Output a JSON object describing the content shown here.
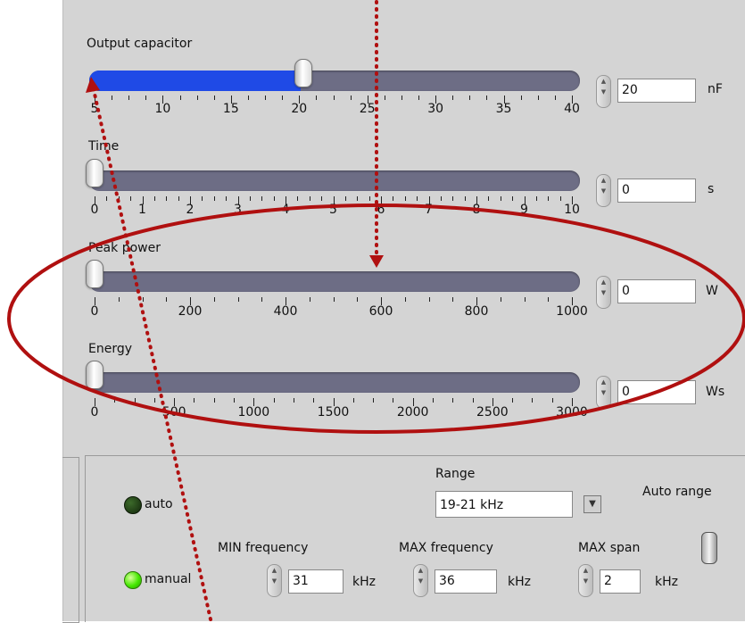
{
  "sliders": {
    "output_capacitor": {
      "label": "Output capacitor",
      "value": "20",
      "unit": "nF",
      "ticks": [
        "5",
        "10",
        "15",
        "20",
        "25",
        "30",
        "35",
        "40"
      ],
      "level": 0.43
    },
    "time": {
      "label": "Time",
      "value": "0",
      "unit": "s",
      "ticks": [
        "0",
        "1",
        "2",
        "3",
        "4",
        "5",
        "6",
        "7",
        "8",
        "9",
        "10"
      ],
      "level": 0
    },
    "peak_power": {
      "label": "Peak power",
      "value": "0",
      "unit": "W",
      "ticks": [
        "0",
        "200",
        "400",
        "600",
        "800",
        "1000"
      ],
      "level": 0
    },
    "energy": {
      "label": "Energy",
      "value": "0",
      "unit": "Ws",
      "ticks": [
        "0",
        "500",
        "1000",
        "1500",
        "2000",
        "2500",
        "3000"
      ],
      "level": 0
    }
  },
  "frequency": {
    "range_label": "Range",
    "range_value": "19-21 kHz",
    "auto_range_label": "Auto range",
    "auto_label": "auto",
    "manual_label": "manual",
    "min_label": "MIN frequency",
    "min_value": "31",
    "max_label": "MAX frequency",
    "max_value": "36",
    "span_label": "MAX span",
    "span_value": "2",
    "unit": "kHz"
  },
  "colors": {
    "accent_fill": "#1f4ae6",
    "track": "#6d6d85",
    "annotation": "#b01010",
    "led_on": "#44e800",
    "led_off": "#1d3a12"
  }
}
